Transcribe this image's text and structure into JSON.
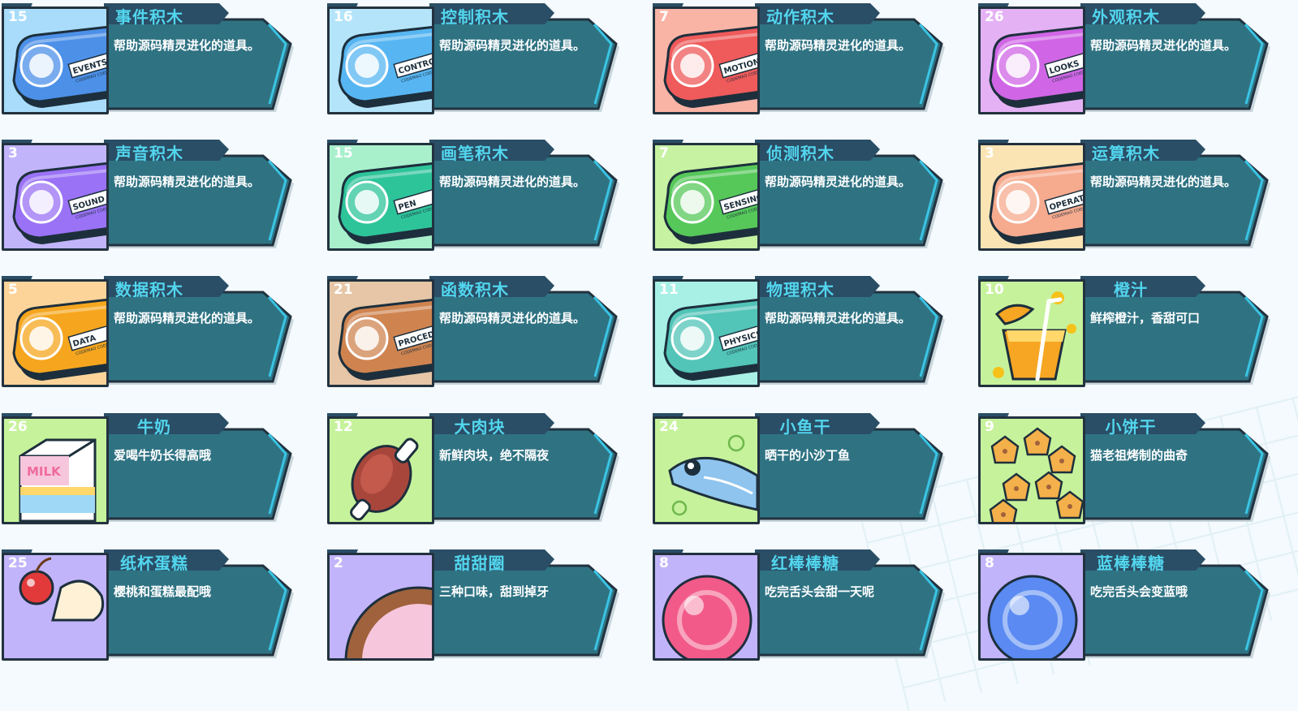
{
  "items": [
    {
      "count": "15",
      "name": "事件积木",
      "desc": "帮助源码精灵进化的道具。",
      "kind": "key",
      "bg": "#a8dcfa",
      "fill": "#4c90e8",
      "label": "EVENTS",
      "icon": "toggle-icon",
      "colors": {
        "accent": "#4c90e8",
        "bg": "#a8dcfa"
      }
    },
    {
      "count": "16",
      "name": "控制积木",
      "desc": "帮助源码精灵进化的道具。",
      "kind": "key",
      "bg": "#b4e4fa",
      "fill": "#57b6f2",
      "label": "CONTROL",
      "icon": "gamepad-icon",
      "colors": {
        "accent": "#57b6f2",
        "bg": "#b4e4fa"
      }
    },
    {
      "count": "7",
      "name": "动作积木",
      "desc": "帮助源码精灵进化的道具。",
      "kind": "key",
      "bg": "#f9b4a6",
      "fill": "#ef5a5a",
      "label": "MOTION",
      "icon": "ghost-icon",
      "colors": {
        "accent": "#ef5a5a",
        "bg": "#f9b4a6"
      }
    },
    {
      "count": "26",
      "name": "外观积木",
      "desc": "帮助源码精灵进化的道具。",
      "kind": "key",
      "bg": "#e4b2f4",
      "fill": "#d066e6",
      "label": "LOOKS",
      "icon": "tshirt-icon",
      "colors": {
        "accent": "#d066e6",
        "bg": "#e4b2f4"
      }
    },
    {
      "count": "3",
      "name": "声音积木",
      "desc": "帮助源码精灵进化的道具。",
      "kind": "key",
      "bg": "#c2b4fa",
      "fill": "#9a72f6",
      "label": "SOUND",
      "icon": "microphone-icon",
      "colors": {
        "accent": "#9a72f6",
        "bg": "#c2b4fa"
      }
    },
    {
      "count": "15",
      "name": "画笔积木",
      "desc": "帮助源码精灵进化的道具。",
      "kind": "key",
      "bg": "#a8f0cc",
      "fill": "#2ec49a",
      "label": "PEN",
      "icon": "pen-icon",
      "colors": {
        "accent": "#2ec49a",
        "bg": "#a8f0cc"
      }
    },
    {
      "count": "7",
      "name": "侦测积木",
      "desc": "帮助源码精灵进化的道具。",
      "kind": "key",
      "bg": "#c6f2a2",
      "fill": "#56c85a",
      "label": "SENSING",
      "icon": "target-icon",
      "colors": {
        "accent": "#56c85a",
        "bg": "#c6f2a2"
      }
    },
    {
      "count": "3",
      "name": "运算积木",
      "desc": "帮助源码精灵进化的道具。",
      "kind": "key",
      "bg": "#fbe4b4",
      "fill": "#f6aa8e",
      "label": "OPERATOR",
      "icon": "calculator-icon",
      "colors": {
        "accent": "#f6aa8e",
        "bg": "#fbe4b4"
      }
    },
    {
      "count": "5",
      "name": "数据积木",
      "desc": "帮助源码精灵进化的道具。",
      "kind": "key",
      "bg": "#fcd49a",
      "fill": "#f6a61e",
      "label": "DATA",
      "icon": "bar-chart-icon",
      "colors": {
        "accent": "#f6a61e",
        "bg": "#fcd49a"
      }
    },
    {
      "count": "21",
      "name": "函数积木",
      "desc": "帮助源码精灵进化的道具。",
      "kind": "key",
      "bg": "#e6c6a6",
      "fill": "#cf8450",
      "label": "PROCEDURE",
      "icon": "function-icon",
      "colors": {
        "accent": "#cf8450",
        "bg": "#e6c6a6"
      }
    },
    {
      "count": "11",
      "name": "物理积木",
      "desc": "帮助源码精灵进化的道具。",
      "kind": "key",
      "bg": "#a8f0e6",
      "fill": "#52c4b8",
      "label": "PHYSICS",
      "icon": "magnet-icon",
      "colors": {
        "accent": "#52c4b8",
        "bg": "#a8f0e6"
      }
    },
    {
      "count": "10",
      "name": "橙汁",
      "desc": "鲜榨橙汁，香甜可口",
      "kind": "juice",
      "bg": "#c6f29c",
      "fill": "#f6a623",
      "icon": "orange-juice-icon",
      "colors": {
        "accent": "#f6a623",
        "bg": "#c6f29c"
      }
    },
    {
      "count": "26",
      "name": "牛奶",
      "desc": "爱喝牛奶长得高哦",
      "kind": "milk",
      "bg": "#c6f29c",
      "fill": "#f06a9a",
      "icon": "milk-carton-icon",
      "colors": {
        "accent": "#f06a9a",
        "bg": "#c6f29c"
      }
    },
    {
      "count": "12",
      "name": "大肉块",
      "desc": "新鲜肉块，绝不隔夜",
      "kind": "meat",
      "bg": "#c6f29c",
      "fill": "#a8463c",
      "icon": "meat-icon",
      "colors": {
        "accent": "#a8463c",
        "bg": "#c6f29c"
      }
    },
    {
      "count": "24",
      "name": "小鱼干",
      "desc": "晒干的小沙丁鱼",
      "kind": "fish",
      "bg": "#c6f29c",
      "fill": "#8ec4ee",
      "icon": "dried-fish-icon",
      "colors": {
        "accent": "#8ec4ee",
        "bg": "#c6f29c"
      }
    },
    {
      "count": "9",
      "name": "小饼干",
      "desc": "猫老祖烤制的曲奇",
      "kind": "cookie",
      "bg": "#c6f29c",
      "fill": "#f4b04a",
      "icon": "cookie-icon",
      "colors": {
        "accent": "#f4b04a",
        "bg": "#c6f29c"
      }
    },
    {
      "count": "25",
      "name": "纸杯蛋糕",
      "desc": "樱桃和蛋糕最配哦",
      "kind": "cupcake",
      "bg": "#c2b4fa",
      "fill": "#e23a3a",
      "icon": "cupcake-icon",
      "colors": {
        "accent": "#e23a3a",
        "bg": "#c2b4fa"
      }
    },
    {
      "count": "2",
      "name": "甜甜圈",
      "desc": "三种口味，甜到掉牙",
      "kind": "donut",
      "bg": "#c2b4fa",
      "fill": "#a0623c",
      "icon": "donut-icon",
      "colors": {
        "accent": "#a0623c",
        "bg": "#c2b4fa"
      }
    },
    {
      "count": "8",
      "name": "红棒棒糖",
      "desc": "吃完舌头会甜一天呢",
      "kind": "candy",
      "bg": "#c2b4fa",
      "fill": "#f25a8a",
      "icon": "red-lollipop-icon",
      "colors": {
        "accent": "#f25a8a",
        "bg": "#c2b4fa"
      }
    },
    {
      "count": "8",
      "name": "蓝棒棒糖",
      "desc": "吃完舌头会变蓝哦",
      "kind": "candy",
      "bg": "#c2b4fa",
      "fill": "#5a8af2",
      "icon": "blue-lollipop-icon",
      "colors": {
        "accent": "#5a8af2",
        "bg": "#c2b4fa"
      }
    }
  ],
  "theme": {
    "panel": "#2f7383",
    "panel_dark": "#2a4e66",
    "outline": "#22323f",
    "cyan": "#3ac4e4",
    "title": "#52d6ee"
  }
}
